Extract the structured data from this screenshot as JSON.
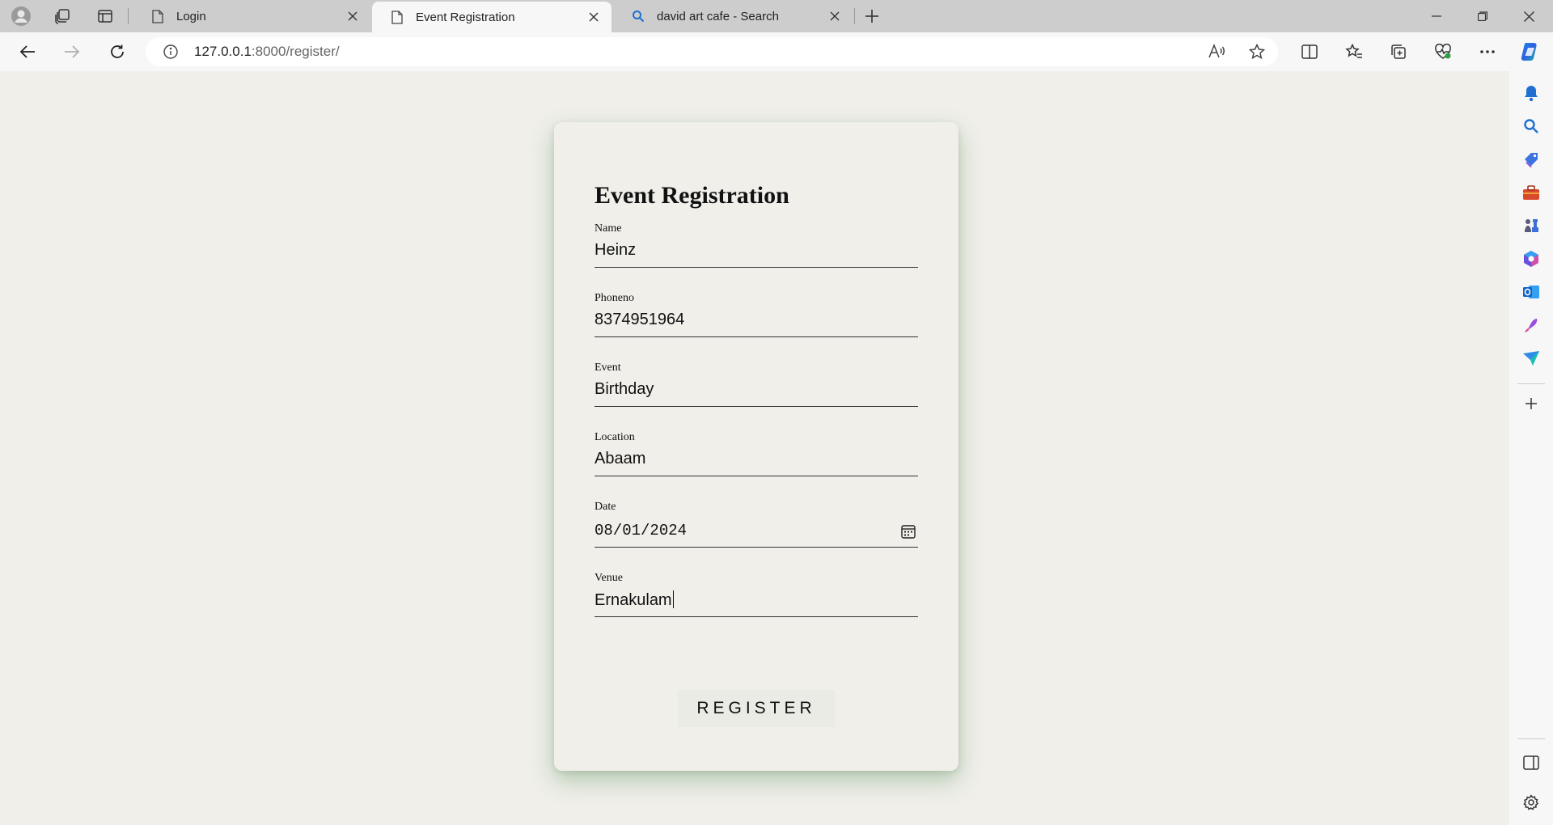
{
  "browser": {
    "tabs": [
      {
        "title": "Login",
        "active": false
      },
      {
        "title": "Event Registration",
        "active": true
      },
      {
        "title": "david art cafe - Search",
        "active": false
      }
    ],
    "url_host": "127.0.0.1",
    "url_rest": ":8000/register/"
  },
  "form": {
    "title": "Event Registration",
    "fields": [
      {
        "label": "Name",
        "value": "Heinz"
      },
      {
        "label": "Phoneno",
        "value": "8374951964"
      },
      {
        "label": "Event",
        "value": "Birthday"
      },
      {
        "label": "Location",
        "value": "Abaam"
      },
      {
        "label": "Date",
        "value": "08/01/2024"
      },
      {
        "label": "Venue",
        "value": "Ernakulam"
      }
    ],
    "submit_label": "REGISTER"
  },
  "colors": {
    "page_bg": "#f0efea",
    "tabstrip_bg": "#cdcdcd",
    "card_shadow": "#8fbf8f"
  }
}
